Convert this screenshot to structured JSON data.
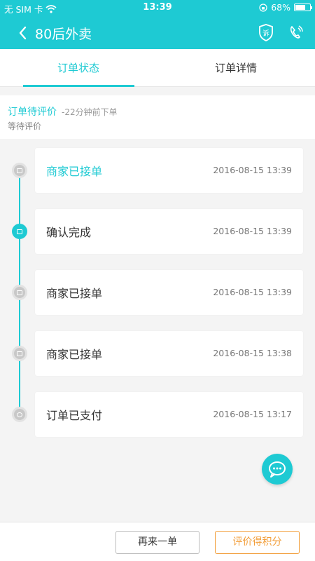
{
  "status_bar": {
    "carrier": "无 SIM 卡",
    "time": "13:39",
    "battery": "68%",
    "battery_level": 0.68
  },
  "header": {
    "back_icon": "chevron-left-icon",
    "title": "80后外卖",
    "actions": [
      {
        "name": "complaint-icon",
        "glyph": "诉"
      },
      {
        "name": "phone-icon"
      }
    ]
  },
  "tabs": [
    {
      "label": "订单状态",
      "active": true
    },
    {
      "label": "订单详情",
      "active": false
    }
  ],
  "summary": {
    "title": "订单待评价",
    "subtitle": "-22分钟前下单",
    "description": "等待评价"
  },
  "timeline": [
    {
      "title": "商家已接单",
      "time": "2016-08-15 13:39",
      "active": true,
      "icon": "store-icon"
    },
    {
      "title": "确认完成",
      "time": "2016-08-15 13:39",
      "active": false,
      "icon": "document-icon"
    },
    {
      "title": "商家已接单",
      "time": "2016-08-15 13:39",
      "active": false,
      "icon": "store-icon"
    },
    {
      "title": "商家已接单",
      "time": "2016-08-15 13:38",
      "active": false,
      "icon": "store-icon"
    },
    {
      "title": "订单已支付",
      "time": "2016-08-15 13:17",
      "active": false,
      "icon": "wallet-icon"
    }
  ],
  "chat": {
    "icon": "chat-bubble-icon"
  },
  "bottom": {
    "reorder_label": "再来一单",
    "review_label": "评价得积分"
  },
  "colors": {
    "accent": "#1ecad3",
    "orange": "#f29d38"
  }
}
